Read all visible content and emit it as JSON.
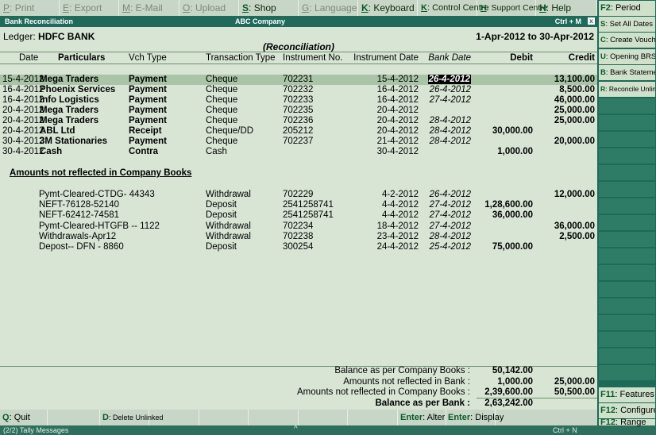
{
  "topbar": [
    {
      "key": "P",
      "label": "Print",
      "active": false
    },
    {
      "key": "E",
      "label": "Export",
      "active": false
    },
    {
      "key": "M",
      "label": "E-Mail",
      "active": false
    },
    {
      "key": "O",
      "label": "Upload",
      "active": false
    },
    {
      "key": "S",
      "label": "Shop",
      "active": true
    },
    {
      "key": "G",
      "label": "Language",
      "active": false
    },
    {
      "key": "K",
      "label": "Keyboard",
      "active": true
    },
    {
      "key": "K",
      "label": "Control Centre",
      "active": true
    },
    {
      "key": "H",
      "label": "Support Centre",
      "active": true
    },
    {
      "key": "H",
      "label": "Help",
      "active": true
    }
  ],
  "titlebar": {
    "left": "Bank Reconciliation",
    "center": "ABC Company",
    "right": "Ctrl + M",
    "close": "x"
  },
  "report": {
    "ledger_label": "Ledger:",
    "ledger_name": "HDFC BANK",
    "period": "1-Apr-2012 to 30-Apr-2012",
    "subtitle": "(Reconciliation)"
  },
  "columns": {
    "date": "Date",
    "particulars": "Particulars",
    "vch_type": "Vch Type",
    "txn_type": "Transaction Type",
    "inst_no": "Instrument No.",
    "inst_date": "Instrument Date",
    "bank_date": "Bank Date",
    "debit": "Debit",
    "credit": "Credit"
  },
  "entries": [
    {
      "date": "15-4-2012",
      "particulars": "Mega Traders",
      "vch_type": "Payment",
      "txn_type": "Cheque",
      "inst_no": "702231",
      "inst_date": "15-4-2012",
      "bank_date": "26-4-2012",
      "debit": "",
      "credit": "13,100.00"
    },
    {
      "date": "16-4-2012",
      "particulars": "Phoenix Services",
      "vch_type": "Payment",
      "txn_type": "Cheque",
      "inst_no": "702232",
      "inst_date": "16-4-2012",
      "bank_date": "26-4-2012",
      "debit": "",
      "credit": "8,500.00"
    },
    {
      "date": "16-4-2012",
      "particulars": "Info Logistics",
      "vch_type": "Payment",
      "txn_type": "Cheque",
      "inst_no": "702233",
      "inst_date": "16-4-2012",
      "bank_date": "27-4-2012",
      "debit": "",
      "credit": "46,000.00"
    },
    {
      "date": "20-4-2012",
      "particulars": "Mega Traders",
      "vch_type": "Payment",
      "txn_type": "Cheque",
      "inst_no": "702235",
      "inst_date": "20-4-2012",
      "bank_date": "",
      "debit": "",
      "credit": "25,000.00"
    },
    {
      "date": "20-4-2012",
      "particulars": "Mega Traders",
      "vch_type": "Payment",
      "txn_type": "Cheque",
      "inst_no": "702236",
      "inst_date": "20-4-2012",
      "bank_date": "28-4-2012",
      "debit": "",
      "credit": "25,000.00"
    },
    {
      "date": "20-4-2012",
      "particulars": "ABL Ltd",
      "vch_type": "Receipt",
      "txn_type": "Cheque/DD",
      "inst_no": "205212",
      "inst_date": "20-4-2012",
      "bank_date": "28-4-2012",
      "debit": "30,000.00",
      "credit": ""
    },
    {
      "date": "30-4-2012",
      "particulars": "3M Stationaries",
      "vch_type": "Payment",
      "txn_type": "Cheque",
      "inst_no": "702237",
      "inst_date": "21-4-2012",
      "bank_date": "28-4-2012",
      "debit": "",
      "credit": "20,000.00"
    },
    {
      "date": "30-4-2012",
      "particulars": "Cash",
      "vch_type": "Contra",
      "txn_type": "Cash",
      "inst_no": "",
      "inst_date": "30-4-2012",
      "bank_date": "",
      "debit": "1,000.00",
      "credit": ""
    }
  ],
  "not_reflected_title": "Amounts not reflected in Company Books",
  "not_reflected": [
    {
      "particulars": "Pymt-Cleared-CTDG- 44343",
      "txn_type": "Withdrawal",
      "inst_no": "702229",
      "inst_date": "4-2-2012",
      "bank_date": "26-4-2012",
      "debit": "",
      "credit": "12,000.00"
    },
    {
      "particulars": "NEFT-76128-52140",
      "txn_type": "Deposit",
      "inst_no": "2541258741",
      "inst_date": "4-4-2012",
      "bank_date": "27-4-2012",
      "debit": "1,28,600.00",
      "credit": ""
    },
    {
      "particulars": "NEFT-62412-74581",
      "txn_type": "Deposit",
      "inst_no": "2541258741",
      "inst_date": "4-4-2012",
      "bank_date": "27-4-2012",
      "debit": "36,000.00",
      "credit": ""
    },
    {
      "particulars": "Pymt-Cleared-HTGFB -- 1122",
      "txn_type": "Withdrawal",
      "inst_no": "702234",
      "inst_date": "18-4-2012",
      "bank_date": "27-4-2012",
      "debit": "",
      "credit": "36,000.00"
    },
    {
      "particulars": "Withdrawals-Apr12",
      "txn_type": "Withdrawal",
      "inst_no": "702238",
      "inst_date": "23-4-2012",
      "bank_date": "28-4-2012",
      "debit": "",
      "credit": "2,500.00"
    },
    {
      "particulars": "Depost-- DFN - 8860",
      "txn_type": "Deposit",
      "inst_no": "300254",
      "inst_date": "24-4-2012",
      "bank_date": "25-4-2012",
      "debit": "75,000.00",
      "credit": ""
    }
  ],
  "totals": [
    {
      "label": "Balance as per Company Books :",
      "debit": "50,142.00",
      "credit": "",
      "bold": false
    },
    {
      "label": "Amounts not reflected in Bank :",
      "debit": "1,000.00",
      "credit": "25,000.00",
      "bold": false
    },
    {
      "label": "Amounts not reflected in Company Books :",
      "debit": "2,39,600.00",
      "credit": "50,500.00",
      "bold": false
    },
    {
      "label": "Balance as per Bank :",
      "debit": "2,63,242.00",
      "credit": "",
      "bold": true
    }
  ],
  "bottombar": [
    {
      "key": "Q",
      "label": "Quit"
    },
    {
      "key": "",
      "label": ""
    },
    {
      "key": "D",
      "label": "Delete Unlinked"
    },
    {
      "key": "",
      "label": ""
    },
    {
      "key": "",
      "label": ""
    },
    {
      "key": "",
      "label": ""
    },
    {
      "key": "",
      "label": ""
    },
    {
      "key": "",
      "label": ""
    },
    {
      "key": "Enter",
      "label": "Alter"
    },
    {
      "key": "Enter",
      "label": "Display"
    }
  ],
  "statusbar": {
    "left": "(2/2) Tally Messages",
    "center": "^",
    "right": "Ctrl + N"
  },
  "sidebar": [
    {
      "key": "F2",
      "label": "Period"
    },
    {
      "key": "S",
      "label": "Set All Dates"
    },
    {
      "key": "C",
      "label": "Create Voucher"
    },
    {
      "key": "U",
      "label": "Opening BRS"
    },
    {
      "key": "B",
      "label": "Bank Statement"
    },
    {
      "key": "R",
      "label": "Reconcile Unlinked"
    },
    {
      "key": "F11",
      "label": "Features"
    },
    {
      "key": "F12",
      "label": "Configure"
    },
    {
      "key": "F12",
      "label": "Range"
    }
  ]
}
